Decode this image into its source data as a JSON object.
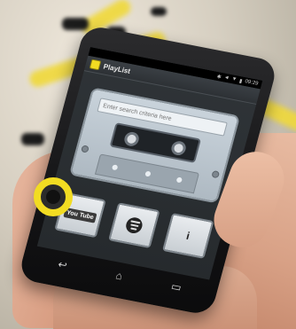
{
  "status_bar": {
    "time": "09:29",
    "icons": [
      "bluetooth-icon",
      "mute-icon",
      "wifi-icon",
      "battery-icon"
    ]
  },
  "app": {
    "title": "PlayList",
    "icon": "playlist-app-icon",
    "accent": "#f2dc22"
  },
  "search": {
    "placeholder": "Enter search criteria here"
  },
  "services": [
    {
      "name": "youtube",
      "label": "You Tube",
      "icon": "youtube-icon"
    },
    {
      "name": "spotify",
      "icon": "spotify-icon"
    },
    {
      "name": "info",
      "label": "i",
      "icon": "info-icon"
    }
  ],
  "navbar": {
    "back": "back-icon",
    "home": "home-icon",
    "recents": "recents-icon"
  }
}
